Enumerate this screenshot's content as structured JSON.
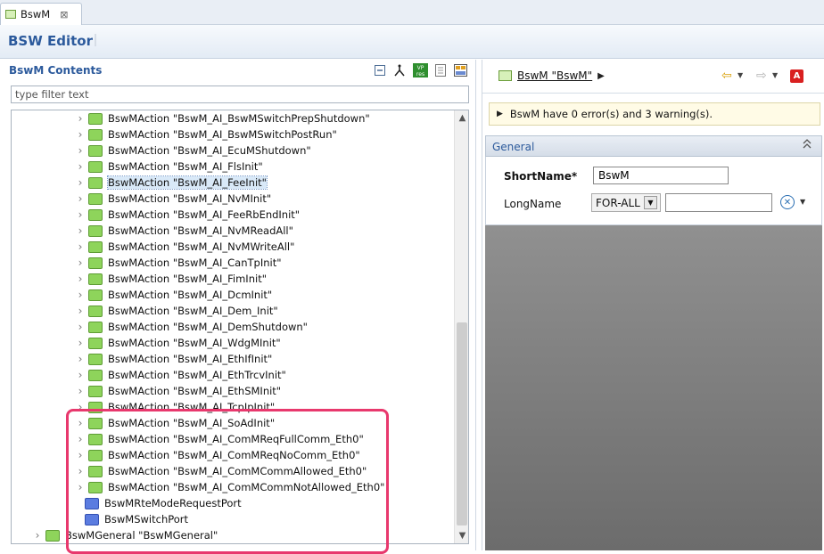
{
  "tab": {
    "label": "BswM",
    "close_glyph": "⊠"
  },
  "editor": {
    "title": "BSW Editor"
  },
  "left_panel": {
    "title": "BswM Contents",
    "toolbar": {
      "collapse_icon": "collapse-all-icon",
      "hierarchy_icon": "hierarchy-icon",
      "vp_icon": "vp-res-icon",
      "doc_icon": "document-icon",
      "layout_icon": "layout-icon"
    },
    "filter_placeholder": "type filter text",
    "tree": [
      {
        "label": "BswMAction \"BswM_AI_BswMSwitchPrepShutdown\"",
        "indent": 1,
        "folder": "green",
        "expander": true
      },
      {
        "label": "BswMAction \"BswM_AI_BswMSwitchPostRun\"",
        "indent": 1,
        "folder": "green",
        "expander": true
      },
      {
        "label": "BswMAction \"BswM_AI_EcuMShutdown\"",
        "indent": 1,
        "folder": "green",
        "expander": true
      },
      {
        "label": "BswMAction \"BswM_AI_FlsInit\"",
        "indent": 1,
        "folder": "green",
        "expander": true
      },
      {
        "label": "BswMAction \"BswM_AI_FeeInit\"",
        "indent": 1,
        "folder": "green",
        "expander": true,
        "selected": true
      },
      {
        "label": "BswMAction \"BswM_AI_NvMInit\"",
        "indent": 1,
        "folder": "green",
        "expander": true
      },
      {
        "label": "BswMAction \"BswM_AI_FeeRbEndInit\"",
        "indent": 1,
        "folder": "green",
        "expander": true
      },
      {
        "label": "BswMAction \"BswM_AI_NvMReadAll\"",
        "indent": 1,
        "folder": "green",
        "expander": true
      },
      {
        "label": "BswMAction \"BswM_AI_NvMWriteAll\"",
        "indent": 1,
        "folder": "green",
        "expander": true
      },
      {
        "label": "BswMAction \"BswM_AI_CanTpInit\"",
        "indent": 1,
        "folder": "green",
        "expander": true
      },
      {
        "label": "BswMAction \"BswM_AI_FimInit\"",
        "indent": 1,
        "folder": "green",
        "expander": true
      },
      {
        "label": "BswMAction \"BswM_AI_DcmInit\"",
        "indent": 1,
        "folder": "green",
        "expander": true
      },
      {
        "label": "BswMAction \"BswM_AI_Dem_Init\"",
        "indent": 1,
        "folder": "green",
        "expander": true
      },
      {
        "label": "BswMAction \"BswM_AI_DemShutdown\"",
        "indent": 1,
        "folder": "green",
        "expander": true
      },
      {
        "label": "BswMAction \"BswM_AI_WdgMInit\"",
        "indent": 1,
        "folder": "green",
        "expander": true
      },
      {
        "label": "BswMAction \"BswM_AI_EthIfInit\"",
        "indent": 1,
        "folder": "green",
        "expander": true
      },
      {
        "label": "BswMAction \"BswM_AI_EthTrcvInit\"",
        "indent": 1,
        "folder": "green",
        "expander": true
      },
      {
        "label": "BswMAction \"BswM_AI_EthSMInit\"",
        "indent": 1,
        "folder": "green",
        "expander": true
      },
      {
        "label": "BswMAction \"BswM_AI_TcpIpInit\"",
        "indent": 1,
        "folder": "green",
        "expander": true
      },
      {
        "label": "BswMAction \"BswM_AI_SoAdInit\"",
        "indent": 1,
        "folder": "green",
        "expander": true
      },
      {
        "label": "BswMAction \"BswM_AI_ComMReqFullComm_Eth0\"",
        "indent": 1,
        "folder": "green",
        "expander": true
      },
      {
        "label": "BswMAction \"BswM_AI_ComMReqNoComm_Eth0\"",
        "indent": 1,
        "folder": "green",
        "expander": true
      },
      {
        "label": "BswMAction \"BswM_AI_ComMCommAllowed_Eth0\"",
        "indent": 1,
        "folder": "green",
        "expander": true
      },
      {
        "label": "BswMAction \"BswM_AI_ComMCommNotAllowed_Eth0\"",
        "indent": 1,
        "folder": "green",
        "expander": true
      },
      {
        "label": "BswMRteModeRequestPort",
        "indent": 2,
        "folder": "blue",
        "expander": false
      },
      {
        "label": "BswMSwitchPort",
        "indent": 2,
        "folder": "blue",
        "expander": false
      },
      {
        "label": "BswMGeneral \"BswMGeneral\"",
        "indent": 0,
        "folder": "green",
        "expander": true
      }
    ]
  },
  "right_panel": {
    "breadcrumb": "BswM \"BswM\"",
    "breadcrumb_arrow": "▶",
    "nav": {
      "back": "⇦",
      "forward": "⇨",
      "dropdown": "▼",
      "acrobat": "A"
    },
    "status": {
      "expander": "▶",
      "text": "BswM have 0 error(s) and 3 warning(s)."
    },
    "section": {
      "title": "General",
      "collapse": "⌃",
      "shortname_label": "ShortName*",
      "shortname_value": "BswM",
      "longname_label": "LongName",
      "longname_lang": "FOR-ALL",
      "longname_value": "",
      "lang_button": "✕",
      "lang_dd": "▼"
    }
  }
}
